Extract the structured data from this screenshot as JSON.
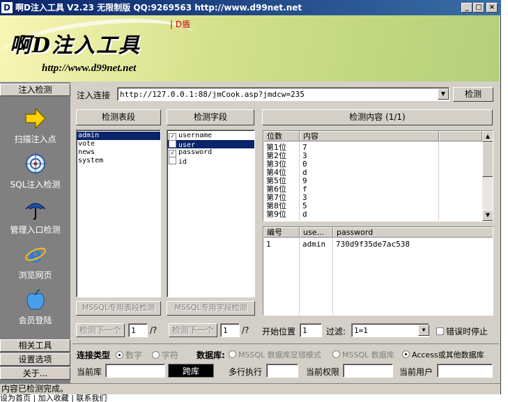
{
  "window": {
    "title": "啊D注入工具 V2.23 无限制版 QQ:9269563 http://www.d99net.net",
    "icon_letter": "D",
    "controls": [
      "_",
      "□",
      "×"
    ]
  },
  "banner": {
    "logo": "啊D注入工具",
    "url": "http://www.d99net.net",
    "tag": "D盾",
    "colors": {
      "left": "#f8f6b5",
      "right": "#b4cf7a"
    }
  },
  "sidebar": {
    "top_header": "注入检测",
    "items": [
      {
        "label": "扫描注入点",
        "icon": "arrow-icon"
      },
      {
        "label": "SQL注入检测",
        "icon": "target-icon"
      },
      {
        "label": "管理入口检测",
        "icon": "umbrella-icon"
      },
      {
        "label": "浏览网页",
        "icon": "ie-icon"
      },
      {
        "label": "会员登陆",
        "icon": "apple-icon"
      }
    ],
    "bottom_headers": [
      "相关工具",
      "设置选项",
      "关于..."
    ]
  },
  "inject": {
    "label": "注入连接",
    "url": "http://127.0.0.1:88/jmCook.asp?jmdcw=235",
    "detect_button": "检测"
  },
  "tables_panel": {
    "header": "检测表段",
    "items": [
      "admin",
      "vote",
      "news",
      "system"
    ],
    "selected": 0,
    "mssql_button": "MSSQL专用表段检测",
    "next_button": "检测下一个",
    "page_value": "1",
    "page_total": "/?"
  },
  "fields_panel": {
    "header": "检测字段",
    "items": [
      {
        "name": "username",
        "checked": true
      },
      {
        "name": "user",
        "checked": false
      },
      {
        "name": "password",
        "checked": true
      },
      {
        "name": "id",
        "checked": false
      }
    ],
    "selected": 1,
    "mssql_button": "MSSQL专用字段检测",
    "next_button": "检测下一个",
    "page_value": "1",
    "page_total": "/?"
  },
  "content_panel": {
    "header": "检测内容 (1/1)",
    "columns": [
      "位数",
      "内容"
    ],
    "rows": [
      [
        "第1位",
        "7"
      ],
      [
        "第2位",
        "3"
      ],
      [
        "第3位",
        "0"
      ],
      [
        "第4位",
        "d"
      ],
      [
        "第5位",
        "9"
      ],
      [
        "第6位",
        "f"
      ],
      [
        "第7位",
        "3"
      ],
      [
        "第8位",
        "5"
      ],
      [
        "第9位",
        "d"
      ]
    ],
    "result_columns": [
      "编号",
      "use...",
      "password"
    ],
    "result_rows": [
      [
        "1",
        "admin",
        "730d9f35de7ac538"
      ]
    ]
  },
  "options": {
    "start_label": "开始位置",
    "start_value": "1",
    "filter_label": "过滤:",
    "filter_value": "1=1",
    "stop_on_error": "错误时停止",
    "conn_type_label": "连接类型",
    "conn_numeric": "数字",
    "conn_string": "字符",
    "db_label": "数据库:",
    "db_mssql_err": "MSSQL 数据库显错模式",
    "db_mssql": "MSSQL 数据库",
    "db_access": "Access或其他数据库",
    "cur_db_label": "当前库",
    "cross_db_button": "跨库",
    "multi_exec_label": "多行执行",
    "cur_perm_label": "当前权限",
    "cur_user_label": "当前用户"
  },
  "status": {
    "text": "内容已检测完成。",
    "below": "设为首页 | 加入收藏 | 联系我们"
  }
}
